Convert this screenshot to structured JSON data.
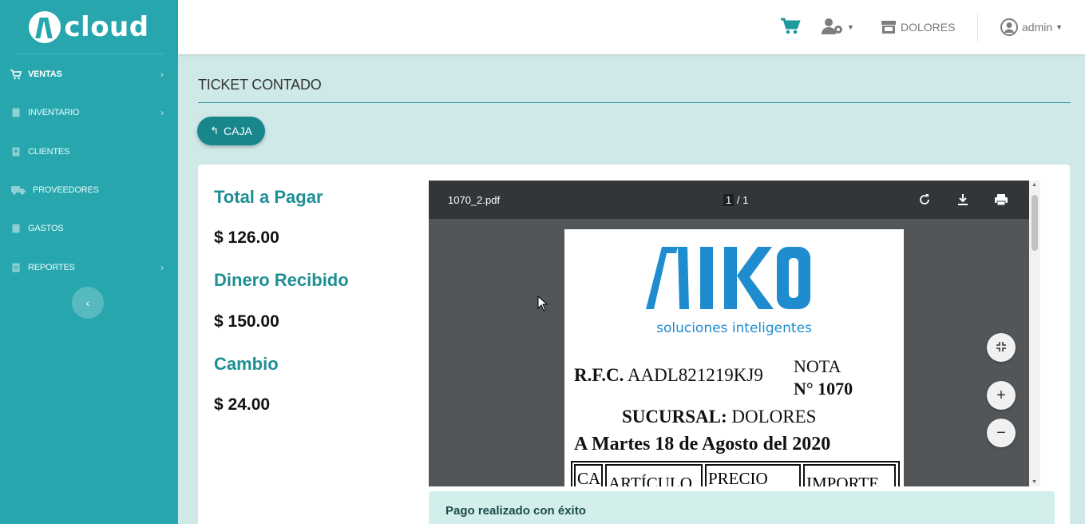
{
  "app": {
    "logo_text": "cloud"
  },
  "sidebar": {
    "items": [
      {
        "label": "VENTAS",
        "icon": "cart-icon",
        "active": true,
        "has_children": true
      },
      {
        "label": "INVENTARIO",
        "icon": "document-icon",
        "active": false,
        "has_children": true
      },
      {
        "label": "CLIENTES",
        "icon": "contact-card-icon",
        "active": false,
        "has_children": false
      },
      {
        "label": "PROVEEDORES",
        "icon": "truck-icon",
        "active": false,
        "has_children": false
      },
      {
        "label": "GASTOS",
        "icon": "document-icon",
        "active": false,
        "has_children": false
      },
      {
        "label": "REPORTES",
        "icon": "report-icon",
        "active": false,
        "has_children": true
      }
    ],
    "collapse_icon": "chevron-left-icon"
  },
  "topbar": {
    "cart_icon": "cart-icon",
    "users_icon": "user-cog-icon",
    "branch_label": "DOLORES",
    "branch_icon": "store-icon",
    "user_label": "admin",
    "user_icon": "user-circle-icon"
  },
  "page": {
    "title": "TICKET CONTADO",
    "back_button_label": "CAJA"
  },
  "payment": {
    "total_label": "Total a Pagar",
    "total_value": "$ 126.00",
    "received_label": "Dinero Recibido",
    "received_value": "$ 150.00",
    "change_label": "Cambio",
    "change_value": "$ 24.00"
  },
  "pdf_viewer": {
    "file_name": "1070_2.pdf",
    "page_current": "1",
    "page_total": "1",
    "page_sep": " / ",
    "document": {
      "logo_text": "AIKO",
      "logo_subtitle": "soluciones inteligentes",
      "rfc_label": "R.F.C.",
      "rfc_value": "AADL821219KJ9",
      "nota_label": "NOTA",
      "nota_number": "N° 1070",
      "sucursal_label": "SUCURSAL:",
      "sucursal_value": "DOLORES",
      "date_line": "A Martes 18 de Agosto del 2020",
      "table_headers": [
        "CA",
        "ARTÍCULO",
        "PRECIO",
        "IMPORTE"
      ]
    }
  },
  "alert": {
    "message": "Pago realizado con éxito"
  },
  "colors": {
    "sidebar": "#27a7ad",
    "accent": "#1f8f94",
    "button": "#17868d",
    "page_bg": "#cfe9e8",
    "aiko_blue": "#1f8ccf"
  }
}
